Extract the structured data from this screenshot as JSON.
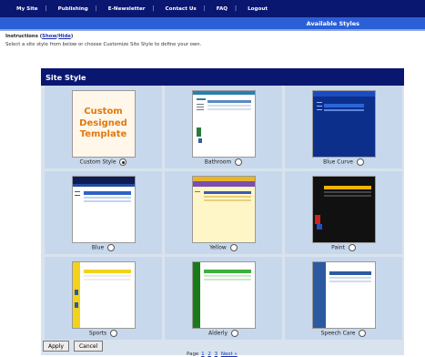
{
  "nav": {
    "items": [
      "My Site",
      "Publishing",
      "E-Newsletter",
      "Contact Us",
      "FAQ",
      "Logout"
    ]
  },
  "title": "Available Styles",
  "instructions": {
    "label": "Instructions",
    "toggle_show": "Show",
    "toggle_hide": "Hide",
    "text": "Select a site style from below or choose Customize Site Style to define your own."
  },
  "panel": {
    "header": "Site Style"
  },
  "styles": [
    {
      "name": "Custom Style",
      "checked": true,
      "custom_text": [
        "Custom",
        "Designed",
        "Template"
      ]
    },
    {
      "name": "Bathroom",
      "checked": false
    },
    {
      "name": "Blue Curve",
      "checked": false
    },
    {
      "name": "Blue",
      "checked": false
    },
    {
      "name": "Yellow",
      "checked": false
    },
    {
      "name": "Paint",
      "checked": false
    },
    {
      "name": "Sports",
      "checked": false
    },
    {
      "name": "Alderly",
      "checked": false
    },
    {
      "name": "Speech Care",
      "checked": false
    }
  ],
  "buttons": {
    "apply": "Apply",
    "cancel": "Cancel"
  },
  "pagination": {
    "label": "Page",
    "pages": [
      "1",
      "2",
      "3"
    ],
    "next": "Next »"
  }
}
